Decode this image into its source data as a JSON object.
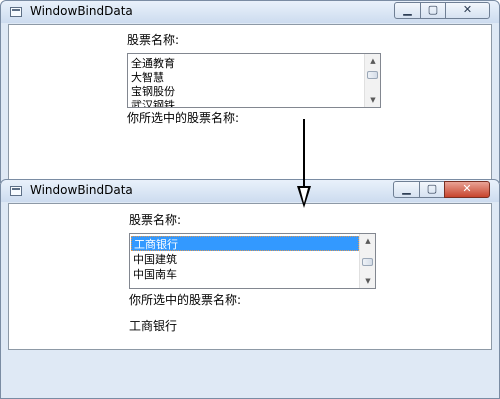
{
  "window1": {
    "title": "WindowBindData",
    "label_stock_name": "股票名称:",
    "list_items": [
      "全通教育",
      "大智慧",
      "宝钢股份",
      "武汉钢铁"
    ],
    "label_selected": "你所选中的股票名称:",
    "selected_value": ""
  },
  "window2": {
    "title": "WindowBindData",
    "label_stock_name": "股票名称:",
    "list_items": [
      "工商银行",
      "中国建筑",
      "中国南车"
    ],
    "selected_item": "工商银行",
    "label_selected": "你所选中的股票名称:",
    "selected_value": "工商银行"
  },
  "icons": {
    "minimize": "minimize-icon",
    "maximize": "maximize-icon",
    "close": "close-icon",
    "scroll_up": "scroll-up-arrow-icon",
    "scroll_down": "scroll-down-arrow-icon",
    "flow_arrow": "down-arrow-icon"
  },
  "colors": {
    "selection": "#3399ff",
    "close_button": "#c7442c",
    "titlebar": "#dfe9f5"
  }
}
